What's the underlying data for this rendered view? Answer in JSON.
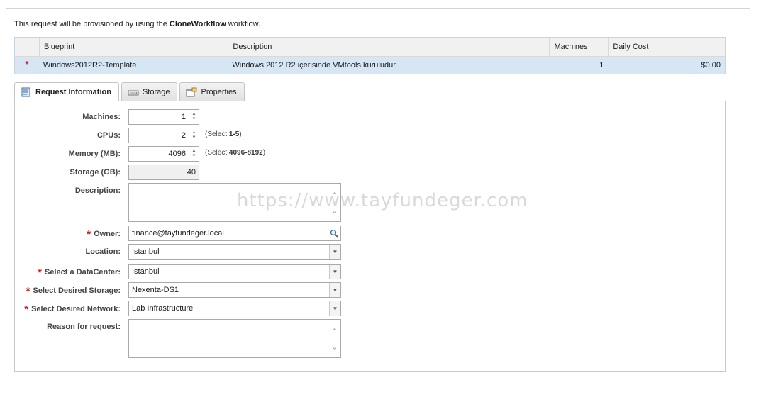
{
  "intro": {
    "prefix": "This request will be provisioned by using the",
    "workflow": "CloneWorkflow",
    "suffix": "workflow."
  },
  "blueprint_table": {
    "headers": [
      "Blueprint",
      "Description",
      "Machines",
      "Daily Cost"
    ],
    "rows": [
      {
        "required_marker": "*",
        "blueprint": "Windows2012R2-Template",
        "description": "Windows 2012 R2 içerisinde VMtools kuruludur.",
        "machines": "1",
        "daily_cost": "$0,00"
      }
    ]
  },
  "tabs": [
    {
      "label": "Request Information",
      "active": true,
      "icon": "request-info-icon"
    },
    {
      "label": "Storage",
      "active": false,
      "icon": "storage-icon"
    },
    {
      "label": "Properties",
      "active": false,
      "icon": "properties-icon"
    }
  ],
  "form": {
    "machines": {
      "label": "Machines:",
      "value": "1"
    },
    "cpus": {
      "label": "CPUs:",
      "value": "2",
      "hint_prefix": "(Select",
      "hint_range": "1-5",
      "hint_suffix": ")"
    },
    "memory": {
      "label": "Memory (MB):",
      "value": "4096",
      "hint_prefix": "(Select",
      "hint_range": "4096-8192",
      "hint_suffix": ")"
    },
    "storage": {
      "label": "Storage (GB):",
      "value": "40"
    },
    "description": {
      "label": "Description:",
      "value": ""
    },
    "owner": {
      "label": "Owner:",
      "value": "finance@tayfundeger.local",
      "required": "*"
    },
    "location": {
      "label": "Location:",
      "value": "Istanbul"
    },
    "datacenter": {
      "label": "Select a DataCenter:",
      "value": "Istanbul",
      "required": "*"
    },
    "desired_storage": {
      "label": "Select Desired Storage:",
      "value": "Nexenta-DS1",
      "required": "*"
    },
    "desired_network": {
      "label": "Select Desired Network:",
      "value": "Lab Infrastructure",
      "required": "*"
    },
    "reason": {
      "label": "Reason for request:",
      "value": ""
    }
  },
  "watermark": "https://www.tayfundeger.com",
  "colors": {
    "required": "#cc1f1f",
    "selected_row": "#d6e6f5",
    "header_bg": "#f1f1f1"
  }
}
